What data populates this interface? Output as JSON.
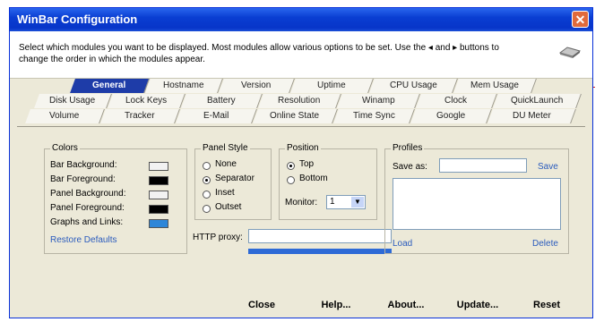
{
  "window": {
    "title": "WinBar Configuration",
    "close_glyph": "✕"
  },
  "header": {
    "text": "Select which modules you want to be displayed. Most modules allow various options to be set. Use the ◂ and ▸ buttons to change the order in which the modules appear.",
    "icon": "chip-icon"
  },
  "tabs": {
    "row1": [
      "General",
      "Hostname",
      "Version",
      "Uptime",
      "CPU Usage",
      "Mem Usage"
    ],
    "row2": [
      "Disk Usage",
      "Lock Keys",
      "Battery",
      "Resolution",
      "Winamp",
      "Clock",
      "QuickLaunch"
    ],
    "row3": [
      "Volume",
      "Tracker",
      "E-Mail",
      "Online State",
      "Time Sync",
      "Google",
      "DU Meter"
    ],
    "active": "General"
  },
  "colors": {
    "label": "Colors",
    "items": [
      {
        "label": "Bar Background:",
        "color": "#f2f2f2"
      },
      {
        "label": "Bar Foreground:",
        "color": "#000000"
      },
      {
        "label": "Panel Background:",
        "color": "#f2f2f2"
      },
      {
        "label": "Panel Foreground:",
        "color": "#000000"
      },
      {
        "label": "Graphs and Links:",
        "color": "#2d86d8"
      }
    ],
    "restore": "Restore Defaults"
  },
  "panel_style": {
    "label": "Panel Style",
    "options": [
      "None",
      "Separator",
      "Inset",
      "Outset"
    ],
    "selected": "Separator"
  },
  "position": {
    "label": "Position",
    "options": [
      "Top",
      "Bottom"
    ],
    "selected": "Top",
    "monitor_label": "Monitor:",
    "monitor_value": "1"
  },
  "profiles": {
    "label": "Profiles",
    "save_as_label": "Save as:",
    "save": "Save",
    "load": "Load",
    "delete": "Delete"
  },
  "http": {
    "label": "HTTP proxy:",
    "value": ""
  },
  "buttons": {
    "close": "Close",
    "help": "Help...",
    "about": "About...",
    "update": "Update...",
    "reset": "Reset"
  },
  "annotation_color": "#d21f1f"
}
